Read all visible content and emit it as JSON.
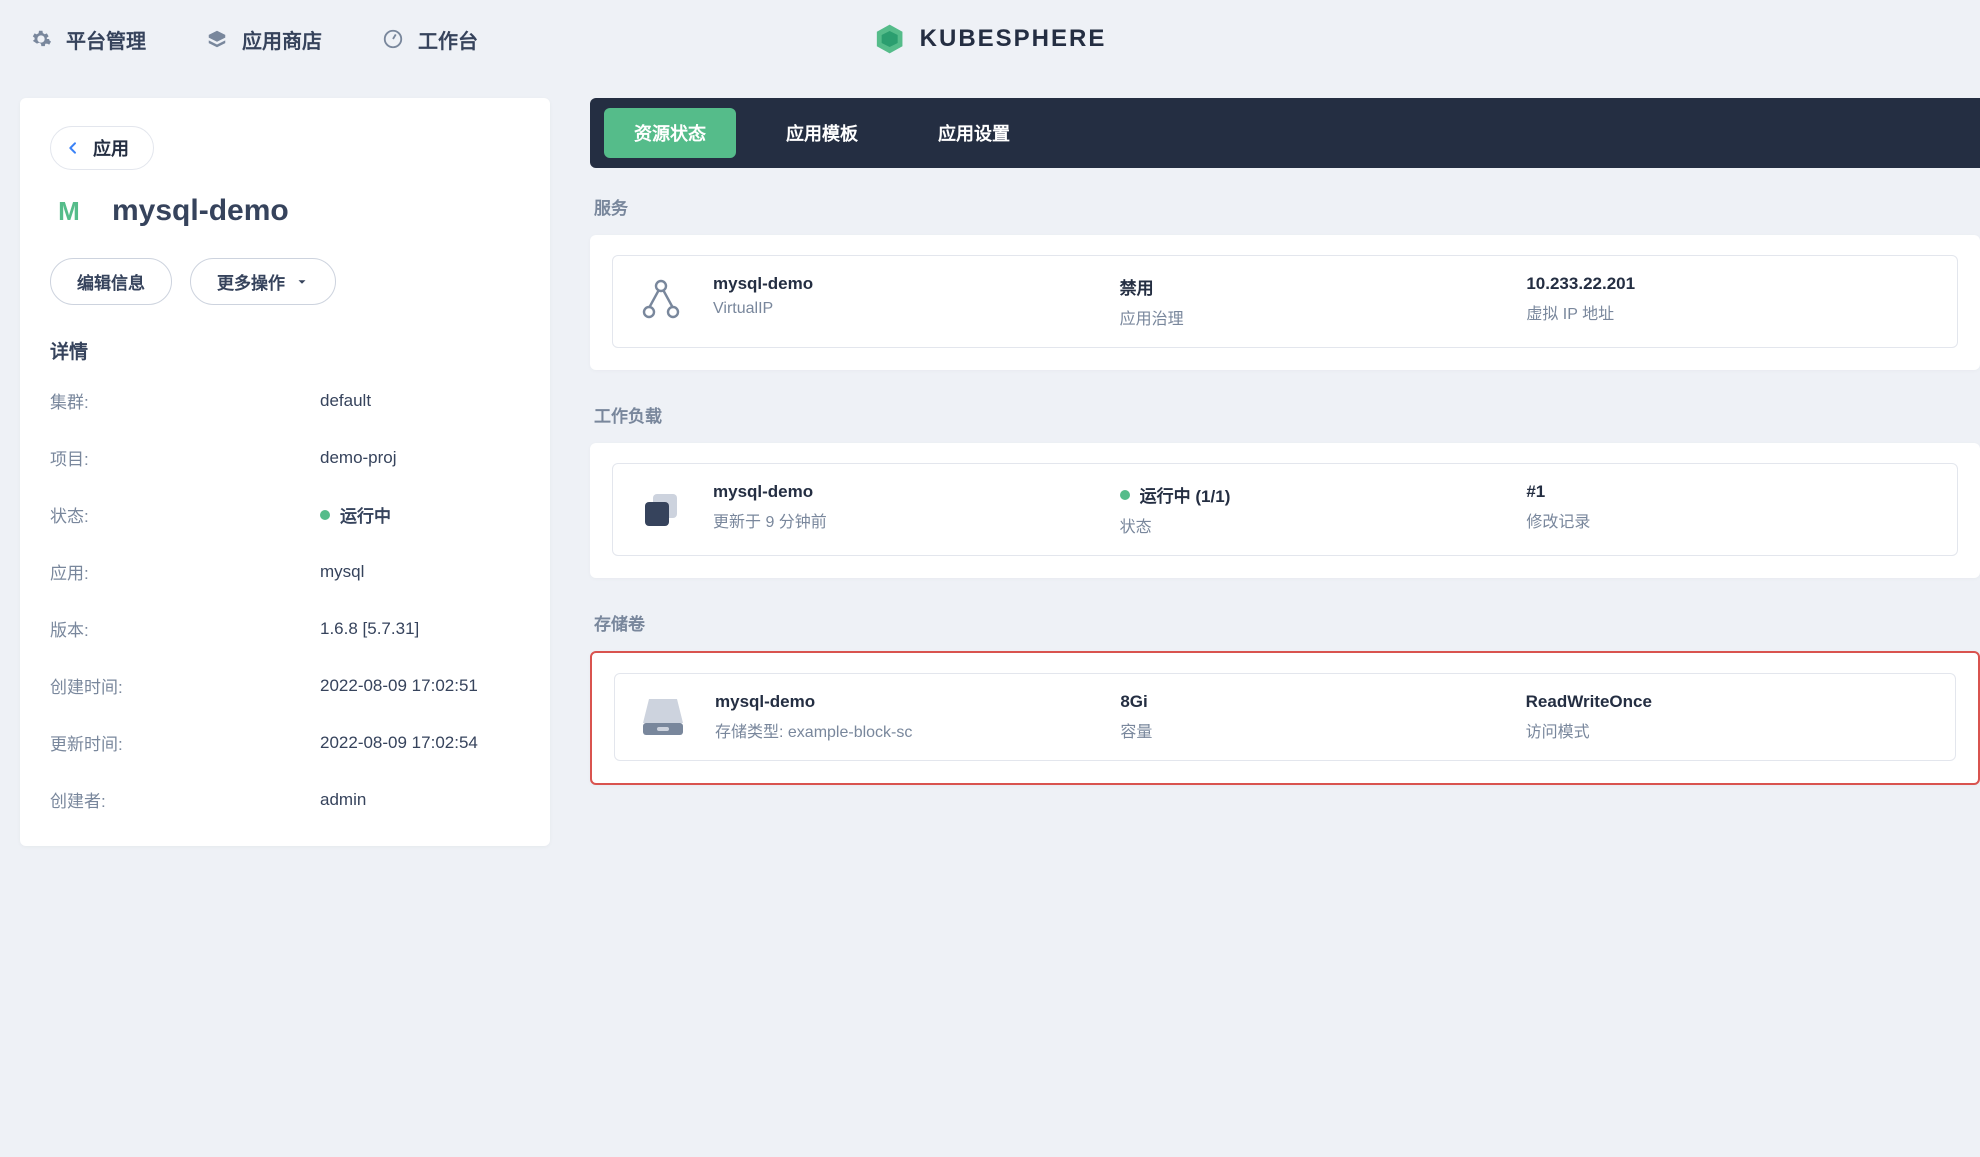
{
  "header": {
    "nav": {
      "platform": "平台管理",
      "store": "应用商店",
      "workbench": "工作台"
    },
    "brand": "KUBESPHERE"
  },
  "side": {
    "back_label": "应用",
    "app_letter": "M",
    "app_name": "mysql-demo",
    "edit_btn": "编辑信息",
    "more_btn": "更多操作",
    "details_header": "详情",
    "labels": {
      "cluster": "集群:",
      "project": "项目:",
      "status": "状态:",
      "app": "应用:",
      "version": "版本:",
      "created": "创建时间:",
      "updated": "更新时间:",
      "creator": "创建者:"
    },
    "values": {
      "cluster": "default",
      "project": "demo-proj",
      "status": "运行中",
      "app": "mysql",
      "version": "1.6.8 [5.7.31]",
      "created": "2022-08-09 17:02:51",
      "updated": "2022-08-09 17:02:54",
      "creator": "admin"
    }
  },
  "tabs": {
    "res": "资源状态",
    "tmpl": "应用模板",
    "settings": "应用设置"
  },
  "sections": {
    "services": "服务",
    "workloads": "工作负载",
    "volumes": "存储卷"
  },
  "service": {
    "name": "mysql-demo",
    "type": "VirtualIP",
    "gov_status": "禁用",
    "gov_label": "应用治理",
    "ip": "10.233.22.201",
    "ip_label": "虚拟 IP 地址"
  },
  "workload": {
    "name": "mysql-demo",
    "updated": "更新于 9 分钟前",
    "status": "运行中 (1/1)",
    "status_label": "状态",
    "rev": "#1",
    "rev_label": "修改记录"
  },
  "volume": {
    "name": "mysql-demo",
    "sc": "存储类型: example-block-sc",
    "capacity": "8Gi",
    "capacity_label": "容量",
    "mode": "ReadWriteOnce",
    "mode_label": "访问模式"
  }
}
